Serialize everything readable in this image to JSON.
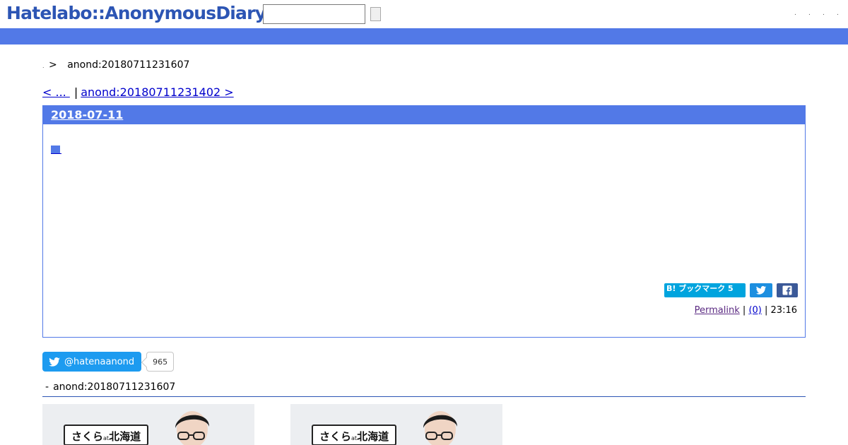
{
  "header": {
    "logo_text": "Hatelabo::AnonymousDiary",
    "search_value": "",
    "links": [
      ".",
      ".",
      ".",
      "."
    ]
  },
  "breadcrumb": {
    "root": ".",
    "separator": ">",
    "current": "anond:20180711231607"
  },
  "pager": {
    "prev_label": "< ... ",
    "separator": "|",
    "next_label": "anond:20180711231402 >"
  },
  "entry": {
    "date": "2018-07-11",
    "bookmark_label": "B! ブックマーク 5",
    "permalink_label": "Permalink",
    "comments_label": "(0)",
    "footer_sep": "|",
    "time": "23:16"
  },
  "twitter": {
    "handle": "@hatenaanond",
    "followers": "965"
  },
  "related": {
    "dash": "-",
    "title": "anond:20180711231607"
  },
  "ads": [
    {
      "label_pre": "さくら",
      "label_at": "at",
      "label_post": "北海道"
    },
    {
      "label_pre": "さくら",
      "label_at": "at",
      "label_post": "北海道"
    }
  ],
  "colors": {
    "accent_blue": "#5279e7",
    "logo_blue": "#2c55b4",
    "hatena_bookmark": "#00a4de",
    "twitter": "#1d9bf0",
    "facebook": "#3b5998"
  },
  "icons": {
    "tweet": "twitter-bird-icon",
    "facebook": "facebook-f-icon"
  }
}
